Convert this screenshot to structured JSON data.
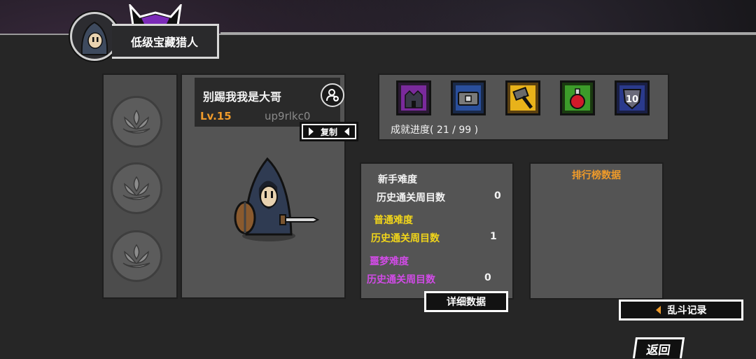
{
  "header": {
    "title": "低级宝藏猎人"
  },
  "profile": {
    "name": "别踢我我是大哥",
    "level": "Lv.15",
    "uid": "up9rlkc0",
    "copy_label": "复制"
  },
  "achievements": {
    "progress_text": "成就进度( 21 / 99 )",
    "badges": [
      {
        "icon": "castle-badge-icon",
        "color": "#7a2a9c"
      },
      {
        "icon": "treasure-chest-badge-icon",
        "color": "#2a4f9c"
      },
      {
        "icon": "hammer-badge-icon",
        "color": "#e8b21a"
      },
      {
        "icon": "potion-badge-icon",
        "color": "#3c9c2a"
      },
      {
        "icon": "shield-10-badge-icon",
        "color": "#2a3a8c",
        "number": "10"
      }
    ]
  },
  "difficulty": {
    "novice": {
      "label": "新手难度",
      "clears_label": "历史通关周目数",
      "clears": "0",
      "color": "#f2f2f2"
    },
    "normal": {
      "label": "普通难度",
      "clears_label": "历史通关周目数",
      "clears": "1",
      "color": "#f1d51a"
    },
    "nightmare": {
      "label": "噩梦难度",
      "clears_label": "历史通关周目数",
      "clears": "0",
      "color": "#d14be6"
    }
  },
  "leaderboard": {
    "title": "排行榜数据"
  },
  "buttons": {
    "details": "详细数据",
    "brawl_record": "乱斗记录",
    "back": "返回"
  }
}
